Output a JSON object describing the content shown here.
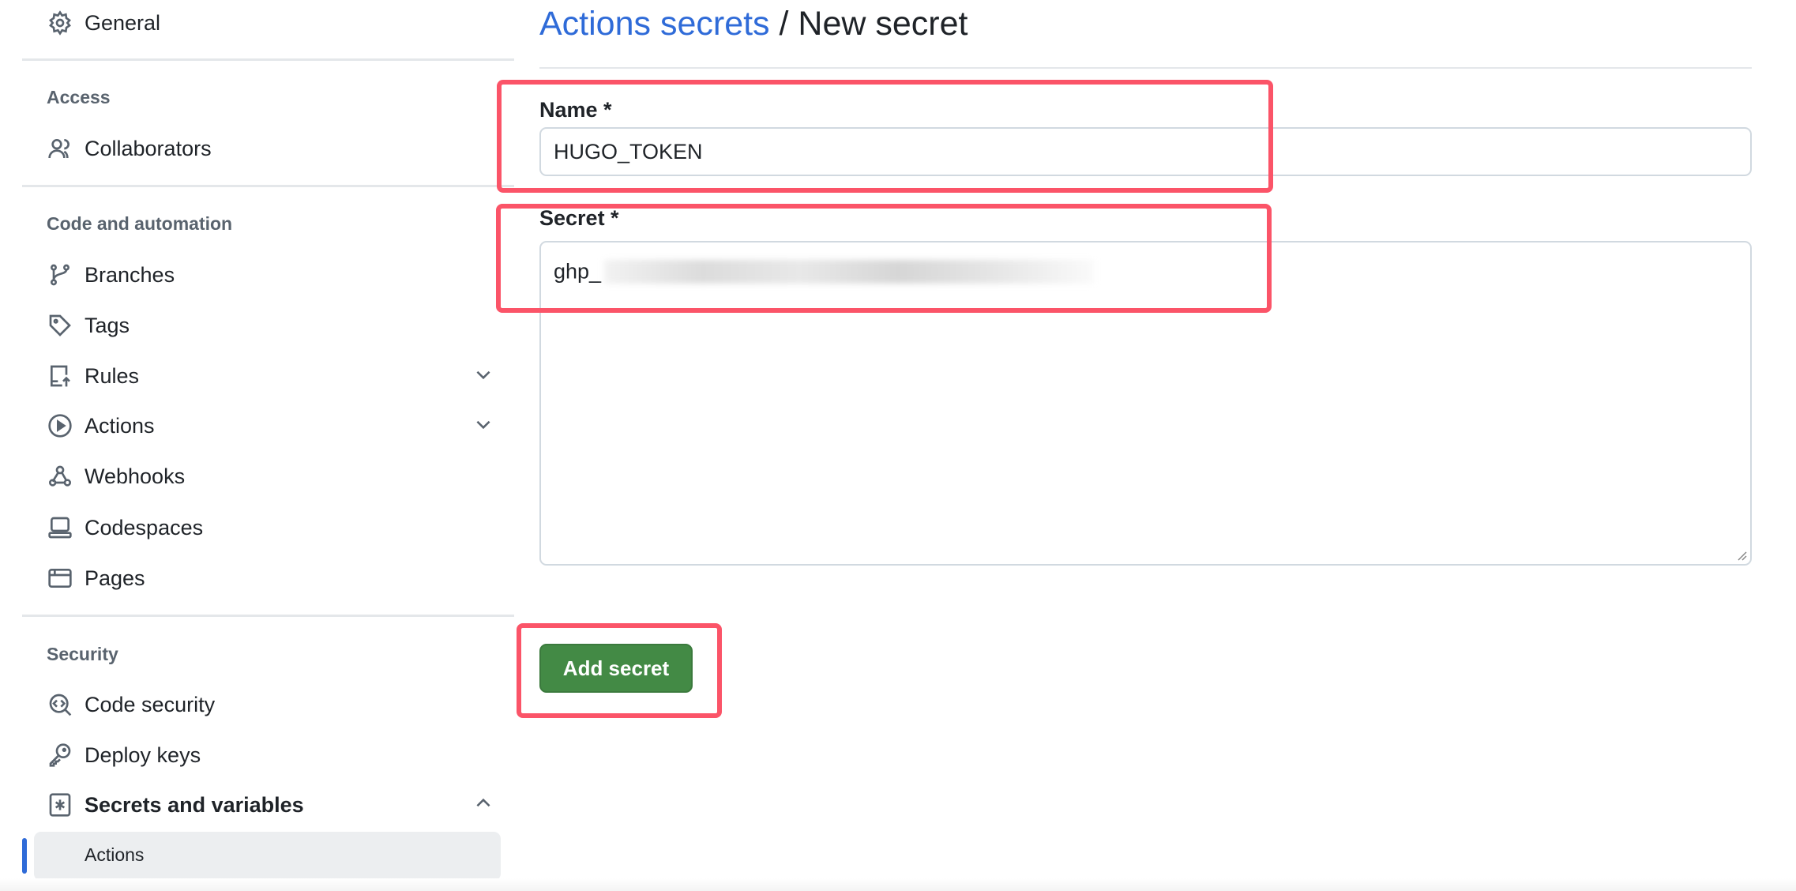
{
  "sidebar": {
    "general": "General",
    "sections": {
      "access": "Access",
      "code_automation": "Code and automation",
      "security": "Security"
    },
    "items": {
      "collaborators": "Collaborators",
      "branches": "Branches",
      "tags": "Tags",
      "rules": "Rules",
      "actions": "Actions",
      "webhooks": "Webhooks",
      "codespaces": "Codespaces",
      "pages": "Pages",
      "code_security": "Code security",
      "deploy_keys": "Deploy keys",
      "secrets_variables": "Secrets and variables",
      "secrets_actions": "Actions"
    },
    "accent_color": "#2f6bd8"
  },
  "main": {
    "breadcrumb_link": "Actions secrets",
    "breadcrumb_separator": " / ",
    "breadcrumb_current": "New secret",
    "name_label": "Name *",
    "name_value": "HUGO_TOKEN",
    "secret_label": "Secret *",
    "secret_value_visible": "ghp_",
    "submit_label": "Add secret",
    "button_color": "#438a45",
    "highlight_color": "#fb5468"
  }
}
